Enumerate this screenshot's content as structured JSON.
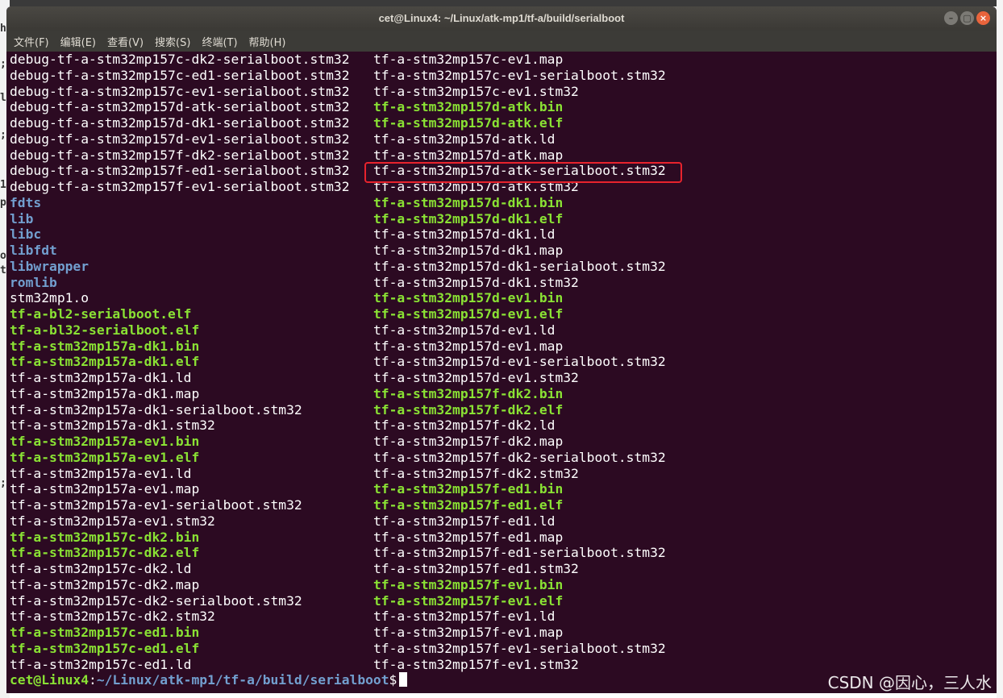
{
  "window": {
    "title": "cet@Linux4: ~/Linux/atk-mp1/tf-a/build/serialboot",
    "buttons": [
      "–",
      "▢",
      "×"
    ]
  },
  "menu": [
    "文件(F)",
    "编辑(E)",
    "查看(V)",
    "搜索(S)",
    "终端(T)",
    "帮助(H)"
  ],
  "colors": {
    "background": "#2c0a22",
    "file": "#ffffff",
    "executable": "#8ae234",
    "directory": "#729fcf",
    "highlight_box": "#e8232d"
  },
  "listing": {
    "left": [
      {
        "name": "debug-tf-a-stm32mp157c-dk2-serialboot.stm32",
        "type": "file"
      },
      {
        "name": "debug-tf-a-stm32mp157c-ed1-serialboot.stm32",
        "type": "file"
      },
      {
        "name": "debug-tf-a-stm32mp157c-ev1-serialboot.stm32",
        "type": "file"
      },
      {
        "name": "debug-tf-a-stm32mp157d-atk-serialboot.stm32",
        "type": "file"
      },
      {
        "name": "debug-tf-a-stm32mp157d-dk1-serialboot.stm32",
        "type": "file"
      },
      {
        "name": "debug-tf-a-stm32mp157d-ev1-serialboot.stm32",
        "type": "file"
      },
      {
        "name": "debug-tf-a-stm32mp157f-dk2-serialboot.stm32",
        "type": "file"
      },
      {
        "name": "debug-tf-a-stm32mp157f-ed1-serialboot.stm32",
        "type": "file"
      },
      {
        "name": "debug-tf-a-stm32mp157f-ev1-serialboot.stm32",
        "type": "file"
      },
      {
        "name": "fdts",
        "type": "dir"
      },
      {
        "name": "lib",
        "type": "dir"
      },
      {
        "name": "libc",
        "type": "dir"
      },
      {
        "name": "libfdt",
        "type": "dir"
      },
      {
        "name": "libwrapper",
        "type": "dir"
      },
      {
        "name": "romlib",
        "type": "dir"
      },
      {
        "name": "stm32mp1.o",
        "type": "file"
      },
      {
        "name": "tf-a-bl2-serialboot.elf",
        "type": "exe"
      },
      {
        "name": "tf-a-bl32-serialboot.elf",
        "type": "exe"
      },
      {
        "name": "tf-a-stm32mp157a-dk1.bin",
        "type": "exe"
      },
      {
        "name": "tf-a-stm32mp157a-dk1.elf",
        "type": "exe"
      },
      {
        "name": "tf-a-stm32mp157a-dk1.ld",
        "type": "file"
      },
      {
        "name": "tf-a-stm32mp157a-dk1.map",
        "type": "file"
      },
      {
        "name": "tf-a-stm32mp157a-dk1-serialboot.stm32",
        "type": "file"
      },
      {
        "name": "tf-a-stm32mp157a-dk1.stm32",
        "type": "file"
      },
      {
        "name": "tf-a-stm32mp157a-ev1.bin",
        "type": "exe"
      },
      {
        "name": "tf-a-stm32mp157a-ev1.elf",
        "type": "exe"
      },
      {
        "name": "tf-a-stm32mp157a-ev1.ld",
        "type": "file"
      },
      {
        "name": "tf-a-stm32mp157a-ev1.map",
        "type": "file"
      },
      {
        "name": "tf-a-stm32mp157a-ev1-serialboot.stm32",
        "type": "file"
      },
      {
        "name": "tf-a-stm32mp157a-ev1.stm32",
        "type": "file"
      },
      {
        "name": "tf-a-stm32mp157c-dk2.bin",
        "type": "exe"
      },
      {
        "name": "tf-a-stm32mp157c-dk2.elf",
        "type": "exe"
      },
      {
        "name": "tf-a-stm32mp157c-dk2.ld",
        "type": "file"
      },
      {
        "name": "tf-a-stm32mp157c-dk2.map",
        "type": "file"
      },
      {
        "name": "tf-a-stm32mp157c-dk2-serialboot.stm32",
        "type": "file"
      },
      {
        "name": "tf-a-stm32mp157c-dk2.stm32",
        "type": "file"
      },
      {
        "name": "tf-a-stm32mp157c-ed1.bin",
        "type": "exe"
      },
      {
        "name": "tf-a-stm32mp157c-ed1.elf",
        "type": "exe"
      },
      {
        "name": "tf-a-stm32mp157c-ed1.ld",
        "type": "file"
      }
    ],
    "right": [
      {
        "name": "tf-a-stm32mp157c-ev1.map",
        "type": "file"
      },
      {
        "name": "tf-a-stm32mp157c-ev1-serialboot.stm32",
        "type": "file"
      },
      {
        "name": "tf-a-stm32mp157c-ev1.stm32",
        "type": "file"
      },
      {
        "name": "tf-a-stm32mp157d-atk.bin",
        "type": "exe"
      },
      {
        "name": "tf-a-stm32mp157d-atk.elf",
        "type": "exe"
      },
      {
        "name": "tf-a-stm32mp157d-atk.ld",
        "type": "file"
      },
      {
        "name": "tf-a-stm32mp157d-atk.map",
        "type": "file"
      },
      {
        "name": "tf-a-stm32mp157d-atk-serialboot.stm32",
        "type": "file"
      },
      {
        "name": "tf-a-stm32mp157d-atk.stm32",
        "type": "file"
      },
      {
        "name": "tf-a-stm32mp157d-dk1.bin",
        "type": "exe"
      },
      {
        "name": "tf-a-stm32mp157d-dk1.elf",
        "type": "exe"
      },
      {
        "name": "tf-a-stm32mp157d-dk1.ld",
        "type": "file"
      },
      {
        "name": "tf-a-stm32mp157d-dk1.map",
        "type": "file"
      },
      {
        "name": "tf-a-stm32mp157d-dk1-serialboot.stm32",
        "type": "file"
      },
      {
        "name": "tf-a-stm32mp157d-dk1.stm32",
        "type": "file"
      },
      {
        "name": "tf-a-stm32mp157d-ev1.bin",
        "type": "exe"
      },
      {
        "name": "tf-a-stm32mp157d-ev1.elf",
        "type": "exe"
      },
      {
        "name": "tf-a-stm32mp157d-ev1.ld",
        "type": "file"
      },
      {
        "name": "tf-a-stm32mp157d-ev1.map",
        "type": "file"
      },
      {
        "name": "tf-a-stm32mp157d-ev1-serialboot.stm32",
        "type": "file"
      },
      {
        "name": "tf-a-stm32mp157d-ev1.stm32",
        "type": "file"
      },
      {
        "name": "tf-a-stm32mp157f-dk2.bin",
        "type": "exe"
      },
      {
        "name": "tf-a-stm32mp157f-dk2.elf",
        "type": "exe"
      },
      {
        "name": "tf-a-stm32mp157f-dk2.ld",
        "type": "file"
      },
      {
        "name": "tf-a-stm32mp157f-dk2.map",
        "type": "file"
      },
      {
        "name": "tf-a-stm32mp157f-dk2-serialboot.stm32",
        "type": "file"
      },
      {
        "name": "tf-a-stm32mp157f-dk2.stm32",
        "type": "file"
      },
      {
        "name": "tf-a-stm32mp157f-ed1.bin",
        "type": "exe"
      },
      {
        "name": "tf-a-stm32mp157f-ed1.elf",
        "type": "exe"
      },
      {
        "name": "tf-a-stm32mp157f-ed1.ld",
        "type": "file"
      },
      {
        "name": "tf-a-stm32mp157f-ed1.map",
        "type": "file"
      },
      {
        "name": "tf-a-stm32mp157f-ed1-serialboot.stm32",
        "type": "file"
      },
      {
        "name": "tf-a-stm32mp157f-ed1.stm32",
        "type": "file"
      },
      {
        "name": "tf-a-stm32mp157f-ev1.bin",
        "type": "exe"
      },
      {
        "name": "tf-a-stm32mp157f-ev1.elf",
        "type": "exe"
      },
      {
        "name": "tf-a-stm32mp157f-ev1.ld",
        "type": "file"
      },
      {
        "name": "tf-a-stm32mp157f-ev1.map",
        "type": "file"
      },
      {
        "name": "tf-a-stm32mp157f-ev1-serialboot.stm32",
        "type": "file"
      },
      {
        "name": "tf-a-stm32mp157f-ev1.stm32",
        "type": "file"
      }
    ],
    "highlighted": "tf-a-stm32mp157d-atk-serialboot.stm32"
  },
  "prompt": {
    "user": "cet@Linux4",
    "sep": ":",
    "path": "~/Linux/atk-mp1/tf-a/build/serialboot",
    "symbol": "$"
  },
  "watermark": "CSDN @因心，三人水"
}
